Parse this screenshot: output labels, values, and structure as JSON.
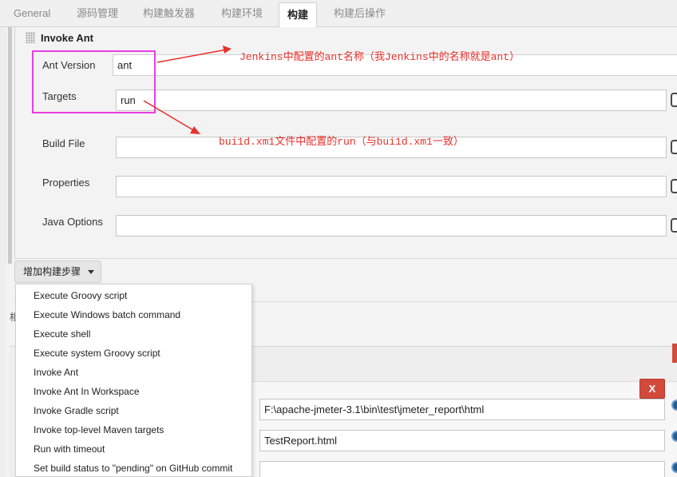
{
  "tabs": [
    "General",
    "源码管理",
    "构建触发器",
    "构建环境",
    "构建",
    "构建后操作"
  ],
  "active_tab": "构建",
  "section": {
    "title": "Invoke Ant",
    "fields": {
      "ant_version": {
        "label": "Ant Version",
        "value": "ant"
      },
      "targets": {
        "label": "Targets",
        "value": "run"
      },
      "build_file": {
        "label": "Build File",
        "value": ""
      },
      "properties": {
        "label": "Properties",
        "value": ""
      },
      "java_options": {
        "label": "Java Options",
        "value": ""
      }
    }
  },
  "annotations": {
    "note1": "Jenkins中配置的ant名称（我Jenkins中的名称就是ant）",
    "note2": "bui1d.xm1文件中配置的run（与bui1d.xm1一致）"
  },
  "add_step_label": "增加构建步骤",
  "menu_items": [
    "Execute Groovy script",
    "Execute Windows batch command",
    "Execute shell",
    "Execute system Groovy script",
    "Invoke Ant",
    "Invoke Ant In Workspace",
    "Invoke Gradle script",
    "Invoke top-level Maven targets",
    "Run with timeout",
    "Set build status to \"pending\" on GitHub commit"
  ],
  "lower": {
    "delete_label": "X",
    "field1": "F:\\apache-jmeter-3.1\\bin\\test\\jmeter_report\\html",
    "field2": "TestReport.html",
    "field3": "",
    "stray_char": "相"
  },
  "colors": {
    "highlight": "#e83ee3",
    "annotation": "#e8302b",
    "delete_button": "#d24a3b"
  }
}
